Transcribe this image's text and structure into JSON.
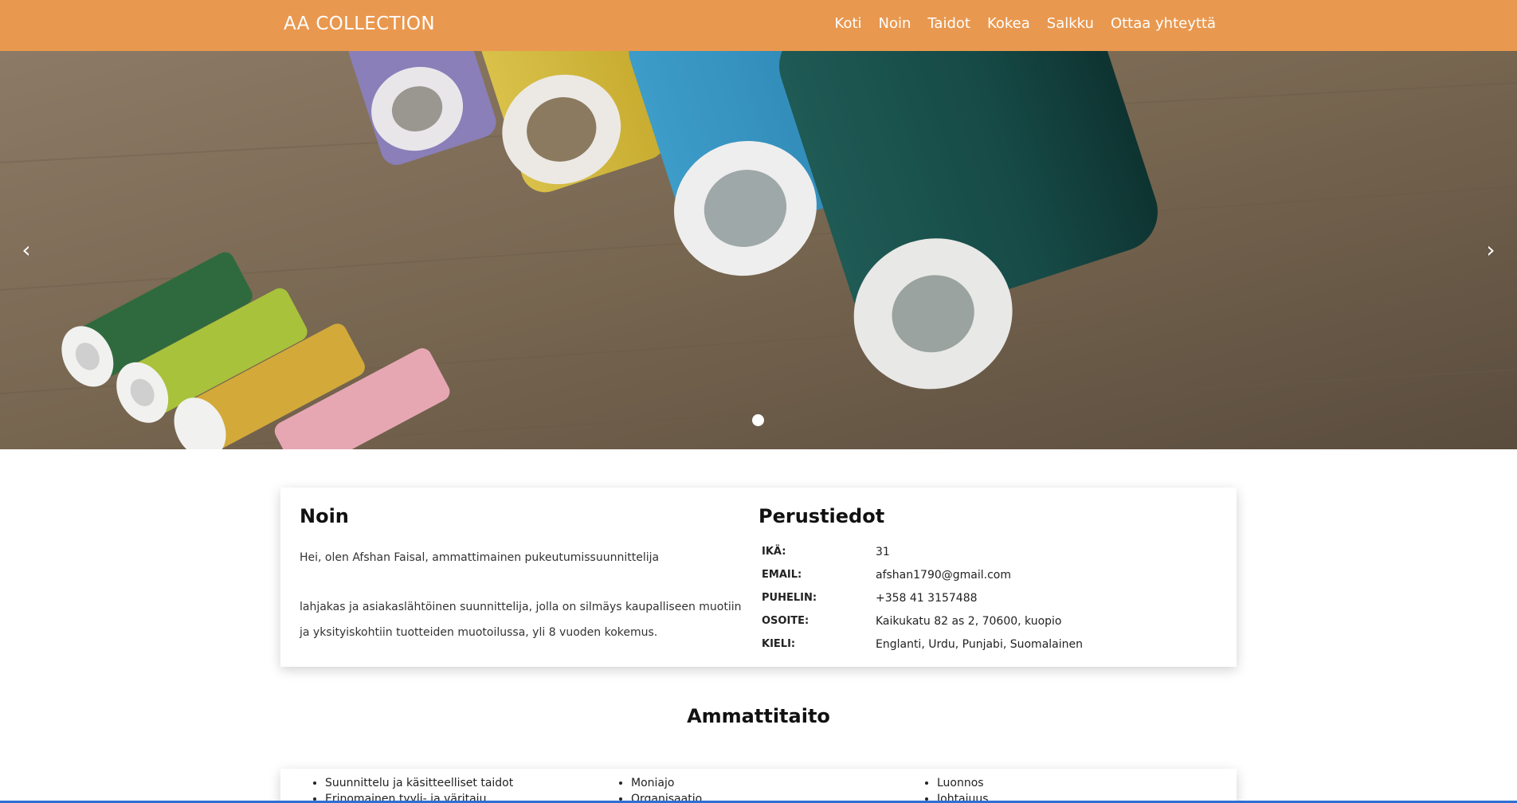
{
  "nav": {
    "brand": "AA COLLECTION",
    "links": [
      "Koti",
      "Noin",
      "Taidot",
      "Kokea",
      "Salkku",
      "Ottaa yhteyttä"
    ]
  },
  "hero": {
    "prev_icon": "‹",
    "next_icon": "›",
    "slides_total": 1,
    "active_slide": 1
  },
  "about": {
    "title": "Noin",
    "intro": "Hei, olen Afshan Faisal, ammattimainen pukeutumissuunnittelija",
    "body": "lahjakas ja asiakaslähtöinen suunnittelija, jolla on silmäys kaupalliseen muotiin ja yksityiskohtiin tuotteiden muotoilussa, yli 8 vuoden kokemus."
  },
  "basics": {
    "title": "Perustiedot",
    "rows": [
      {
        "label": "IKÄ:",
        "value": "31"
      },
      {
        "label": "EMAIL:",
        "value": "afshan1790@gmail.com"
      },
      {
        "label": "PUHELIN:",
        "value": "+358 41 3157488"
      },
      {
        "label": "OSOITE:",
        "value": "Kaikukatu 82 as 2, 70600, kuopio"
      },
      {
        "label": "KIELI:",
        "value": "Englanti, Urdu, Punjabi, Suomalainen"
      }
    ]
  },
  "skills": {
    "title": "Ammattitaito",
    "columns": [
      [
        "Suunnittelu ja käsitteelliset taidot",
        "Erinomainen tyyli- ja väritaju"
      ],
      [
        "Moniajo",
        "Organisaatio"
      ],
      [
        "Luonnos",
        "Johtajuus"
      ]
    ]
  },
  "colors": {
    "nav_background": "#e9984f",
    "accent_line": "#2f6fd4"
  }
}
